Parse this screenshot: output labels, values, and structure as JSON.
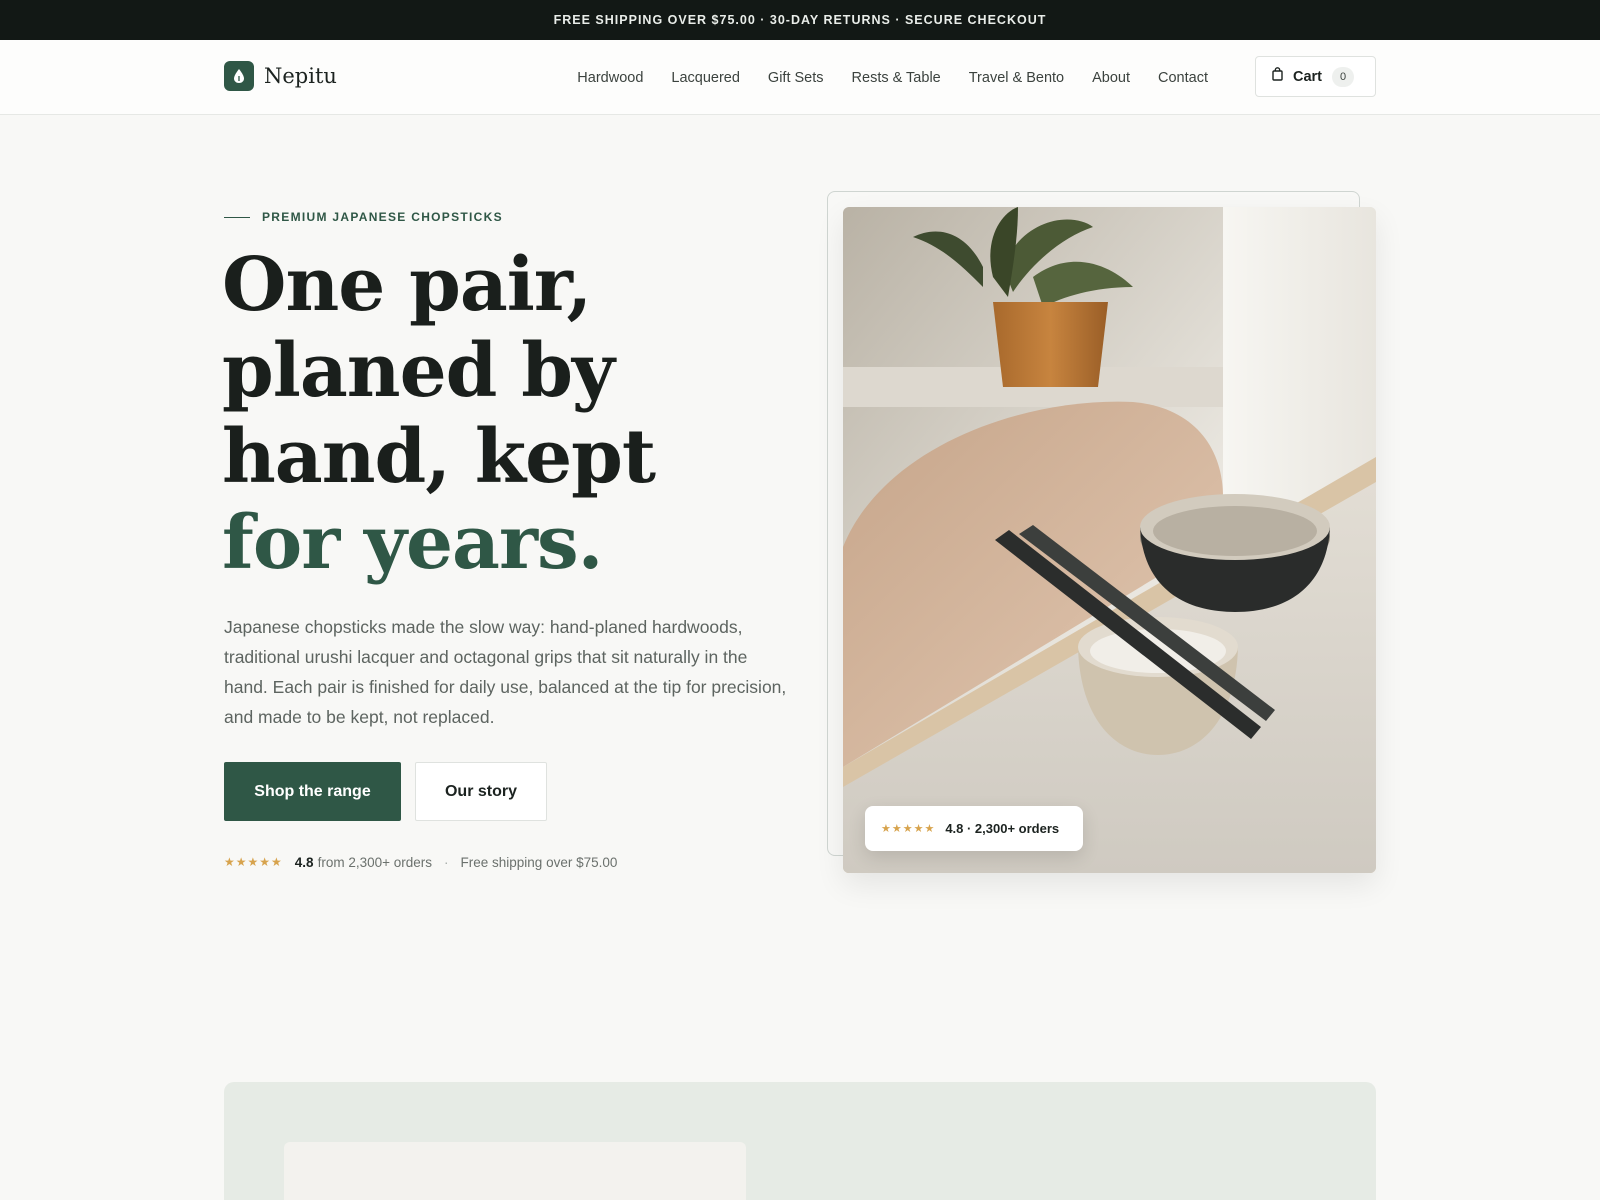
{
  "announcement": "FREE SHIPPING OVER $75.00 · 30-DAY RETURNS · SECURE CHECKOUT",
  "brand": {
    "name": "Nepitu"
  },
  "nav": {
    "items": [
      {
        "label": "Hardwood"
      },
      {
        "label": "Lacquered"
      },
      {
        "label": "Gift Sets"
      },
      {
        "label": "Rests & Table"
      },
      {
        "label": "Travel & Bento"
      },
      {
        "label": "About"
      },
      {
        "label": "Contact"
      }
    ],
    "cart": {
      "label": "Cart",
      "count": "0"
    }
  },
  "hero": {
    "eyebrow": "PREMIUM JAPANESE CHOPSTICKS",
    "headline": [
      "One pair,",
      "planed by",
      "hand, kept",
      "for years."
    ],
    "lede": "Japanese chopsticks made the slow way: hand-planed hardwoods, traditional urushi lacquer and octagonal grips that sit naturally in the hand. Each pair is finished for daily use, balanced at the tip for precision, and made to be kept, not replaced.",
    "primary_cta": "Shop the range",
    "secondary_cta": "Our story",
    "proof": {
      "stars": "★★★★★",
      "rating": "4.8",
      "orders": "from 2,300+ orders",
      "shipping": "Free shipping over $75.00"
    },
    "image_badge": {
      "stars": "★★★★★",
      "text": "4.8 · 2,300+ orders"
    }
  },
  "colors": {
    "brand_green": "#2f5746",
    "announcement_bg": "#121815",
    "star_gold": "#d7a34d",
    "page_bg": "#f8f8f6"
  },
  "icons": {
    "logo": "leaf-drop-icon",
    "cart": "shopping-bag-icon",
    "stars": "star-icon"
  }
}
